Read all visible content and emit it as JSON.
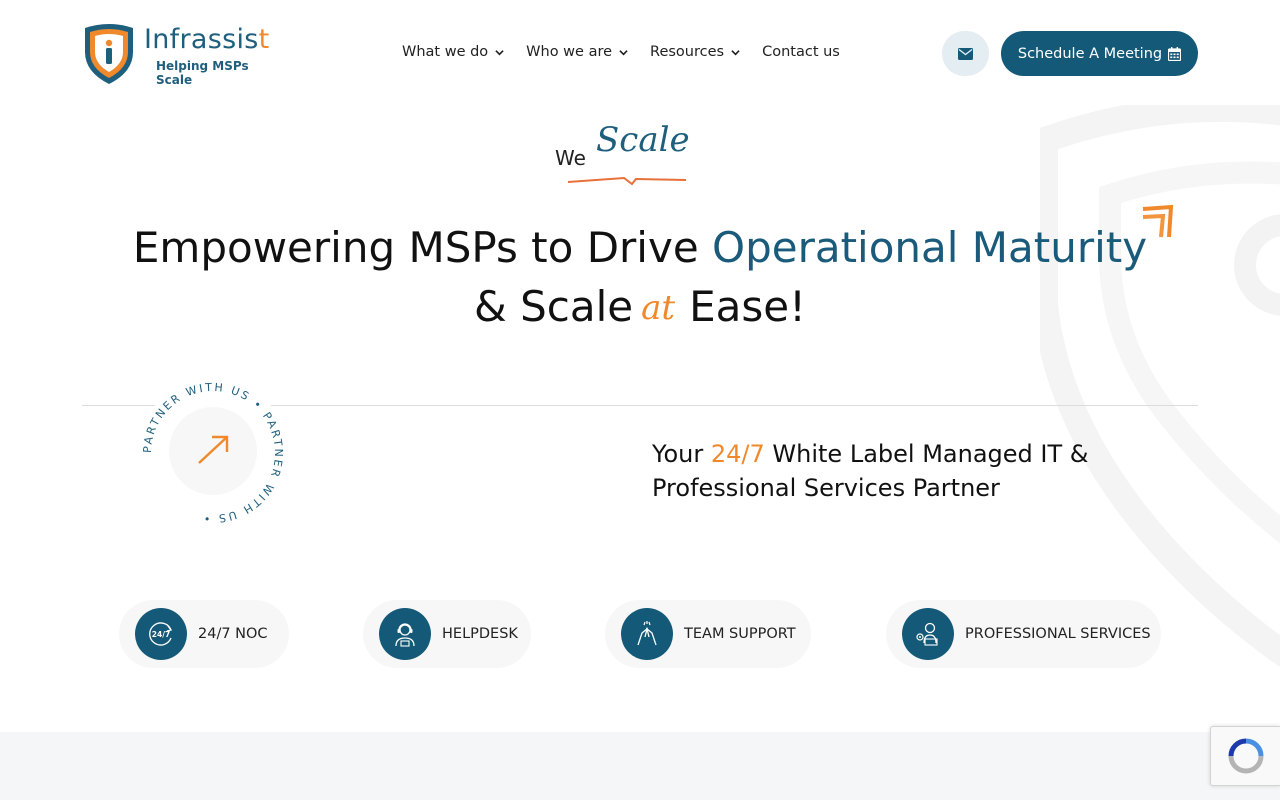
{
  "brand": {
    "name_main": "Infrassis",
    "name_end": "t",
    "tagline": "Helping MSPs Scale",
    "colors": {
      "primary": "#145a78",
      "accent": "#f0892b"
    }
  },
  "nav": {
    "items": [
      {
        "label": "What we do",
        "has_dropdown": true
      },
      {
        "label": "Who we are",
        "has_dropdown": true
      },
      {
        "label": "Resources",
        "has_dropdown": true
      },
      {
        "label": "Contact us",
        "has_dropdown": false
      }
    ],
    "mail_icon": "envelope-icon",
    "cta_label": "Schedule A Meeting",
    "cta_icon": "calendar-icon"
  },
  "hero": {
    "kicker_we": "We",
    "kicker_scale": "Scale",
    "headline_part1": "Empowering MSPs to Drive ",
    "headline_accent": "Operational Maturity",
    "headline_part2": "& Scale",
    "headline_at": "at",
    "headline_part3": "Ease!",
    "badge_text": "PARTNER WITH US • PARTNER WITH US •",
    "badge_icon": "arrow-up-right-icon",
    "tagline_pre": "Your ",
    "tagline_highlight": "24/7",
    "tagline_post": " White Label Managed IT & Professional Services Partner"
  },
  "services": [
    {
      "label": "24/7 NOC",
      "icon": "clock-24-7-icon"
    },
    {
      "label": "HELPDESK",
      "icon": "support-agent-icon"
    },
    {
      "label": "TEAM SUPPORT",
      "icon": "high-five-icon"
    },
    {
      "label": "PROFESSIONAL SERVICES",
      "icon": "engineer-laptop-icon"
    }
  ]
}
